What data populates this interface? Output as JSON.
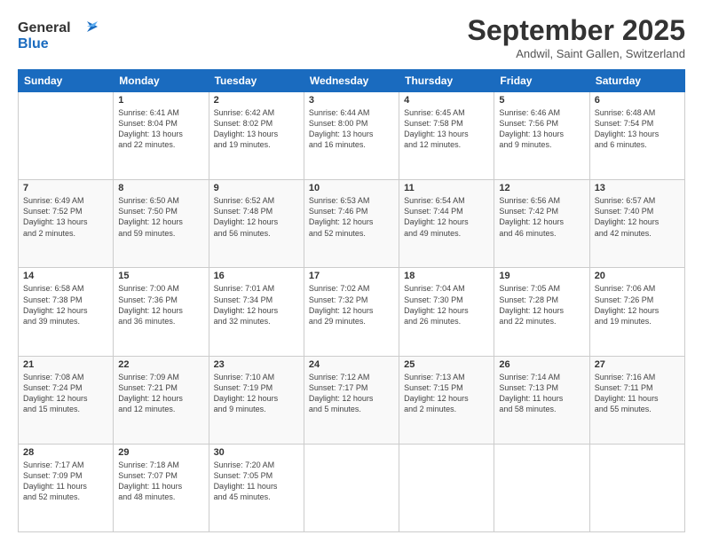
{
  "header": {
    "logo_line1": "General",
    "logo_line2": "Blue",
    "month_title": "September 2025",
    "location": "Andwil, Saint Gallen, Switzerland"
  },
  "days_of_week": [
    "Sunday",
    "Monday",
    "Tuesday",
    "Wednesday",
    "Thursday",
    "Friday",
    "Saturday"
  ],
  "weeks": [
    [
      {
        "day": "",
        "content": ""
      },
      {
        "day": "1",
        "content": "Sunrise: 6:41 AM\nSunset: 8:04 PM\nDaylight: 13 hours\nand 22 minutes."
      },
      {
        "day": "2",
        "content": "Sunrise: 6:42 AM\nSunset: 8:02 PM\nDaylight: 13 hours\nand 19 minutes."
      },
      {
        "day": "3",
        "content": "Sunrise: 6:44 AM\nSunset: 8:00 PM\nDaylight: 13 hours\nand 16 minutes."
      },
      {
        "day": "4",
        "content": "Sunrise: 6:45 AM\nSunset: 7:58 PM\nDaylight: 13 hours\nand 12 minutes."
      },
      {
        "day": "5",
        "content": "Sunrise: 6:46 AM\nSunset: 7:56 PM\nDaylight: 13 hours\nand 9 minutes."
      },
      {
        "day": "6",
        "content": "Sunrise: 6:48 AM\nSunset: 7:54 PM\nDaylight: 13 hours\nand 6 minutes."
      }
    ],
    [
      {
        "day": "7",
        "content": "Sunrise: 6:49 AM\nSunset: 7:52 PM\nDaylight: 13 hours\nand 2 minutes."
      },
      {
        "day": "8",
        "content": "Sunrise: 6:50 AM\nSunset: 7:50 PM\nDaylight: 12 hours\nand 59 minutes."
      },
      {
        "day": "9",
        "content": "Sunrise: 6:52 AM\nSunset: 7:48 PM\nDaylight: 12 hours\nand 56 minutes."
      },
      {
        "day": "10",
        "content": "Sunrise: 6:53 AM\nSunset: 7:46 PM\nDaylight: 12 hours\nand 52 minutes."
      },
      {
        "day": "11",
        "content": "Sunrise: 6:54 AM\nSunset: 7:44 PM\nDaylight: 12 hours\nand 49 minutes."
      },
      {
        "day": "12",
        "content": "Sunrise: 6:56 AM\nSunset: 7:42 PM\nDaylight: 12 hours\nand 46 minutes."
      },
      {
        "day": "13",
        "content": "Sunrise: 6:57 AM\nSunset: 7:40 PM\nDaylight: 12 hours\nand 42 minutes."
      }
    ],
    [
      {
        "day": "14",
        "content": "Sunrise: 6:58 AM\nSunset: 7:38 PM\nDaylight: 12 hours\nand 39 minutes."
      },
      {
        "day": "15",
        "content": "Sunrise: 7:00 AM\nSunset: 7:36 PM\nDaylight: 12 hours\nand 36 minutes."
      },
      {
        "day": "16",
        "content": "Sunrise: 7:01 AM\nSunset: 7:34 PM\nDaylight: 12 hours\nand 32 minutes."
      },
      {
        "day": "17",
        "content": "Sunrise: 7:02 AM\nSunset: 7:32 PM\nDaylight: 12 hours\nand 29 minutes."
      },
      {
        "day": "18",
        "content": "Sunrise: 7:04 AM\nSunset: 7:30 PM\nDaylight: 12 hours\nand 26 minutes."
      },
      {
        "day": "19",
        "content": "Sunrise: 7:05 AM\nSunset: 7:28 PM\nDaylight: 12 hours\nand 22 minutes."
      },
      {
        "day": "20",
        "content": "Sunrise: 7:06 AM\nSunset: 7:26 PM\nDaylight: 12 hours\nand 19 minutes."
      }
    ],
    [
      {
        "day": "21",
        "content": "Sunrise: 7:08 AM\nSunset: 7:24 PM\nDaylight: 12 hours\nand 15 minutes."
      },
      {
        "day": "22",
        "content": "Sunrise: 7:09 AM\nSunset: 7:21 PM\nDaylight: 12 hours\nand 12 minutes."
      },
      {
        "day": "23",
        "content": "Sunrise: 7:10 AM\nSunset: 7:19 PM\nDaylight: 12 hours\nand 9 minutes."
      },
      {
        "day": "24",
        "content": "Sunrise: 7:12 AM\nSunset: 7:17 PM\nDaylight: 12 hours\nand 5 minutes."
      },
      {
        "day": "25",
        "content": "Sunrise: 7:13 AM\nSunset: 7:15 PM\nDaylight: 12 hours\nand 2 minutes."
      },
      {
        "day": "26",
        "content": "Sunrise: 7:14 AM\nSunset: 7:13 PM\nDaylight: 11 hours\nand 58 minutes."
      },
      {
        "day": "27",
        "content": "Sunrise: 7:16 AM\nSunset: 7:11 PM\nDaylight: 11 hours\nand 55 minutes."
      }
    ],
    [
      {
        "day": "28",
        "content": "Sunrise: 7:17 AM\nSunset: 7:09 PM\nDaylight: 11 hours\nand 52 minutes."
      },
      {
        "day": "29",
        "content": "Sunrise: 7:18 AM\nSunset: 7:07 PM\nDaylight: 11 hours\nand 48 minutes."
      },
      {
        "day": "30",
        "content": "Sunrise: 7:20 AM\nSunset: 7:05 PM\nDaylight: 11 hours\nand 45 minutes."
      },
      {
        "day": "",
        "content": ""
      },
      {
        "day": "",
        "content": ""
      },
      {
        "day": "",
        "content": ""
      },
      {
        "day": "",
        "content": ""
      }
    ]
  ]
}
